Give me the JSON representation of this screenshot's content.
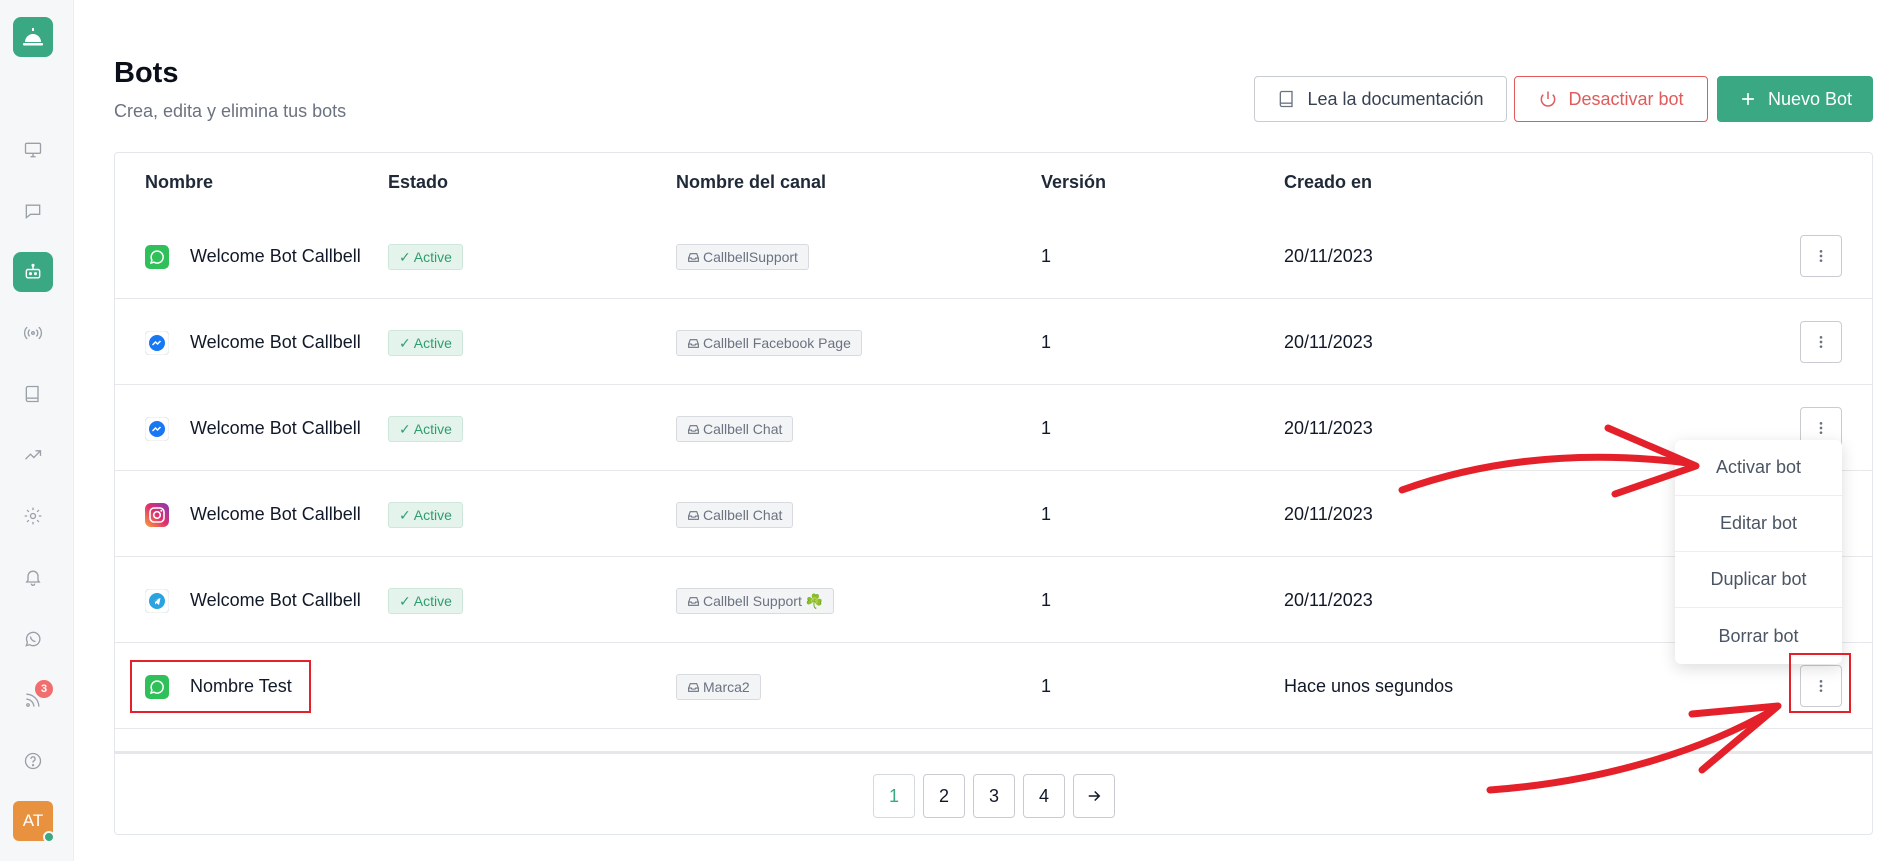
{
  "sidebar": {
    "logo_icon": "service-bell-icon",
    "items": [
      {
        "icon": "monitor-icon"
      },
      {
        "icon": "chat-bubble-icon"
      },
      {
        "icon": "bot-icon",
        "active": true
      },
      {
        "icon": "broadcast-icon"
      },
      {
        "icon": "book-icon"
      },
      {
        "icon": "trending-up-icon"
      },
      {
        "icon": "gear-icon"
      },
      {
        "icon": "bell-icon"
      },
      {
        "icon": "whatsapp-icon"
      },
      {
        "icon": "rss-feed-icon",
        "badge": "3"
      },
      {
        "icon": "help-circle-icon"
      }
    ],
    "avatar_initials": "AT"
  },
  "header": {
    "title": "Bots",
    "subtitle": "Crea, edita y elimina tus bots",
    "docs_button": "Lea la documentación",
    "deactivate_button": "Desactivar bot",
    "new_button": "Nuevo Bot"
  },
  "table": {
    "columns": [
      "Nombre",
      "Estado",
      "Nombre del canal",
      "Versión",
      "Creado en"
    ],
    "rows": [
      {
        "channel_icon": "whatsapp-icon",
        "name": "Welcome Bot Callbell",
        "status": "Active",
        "channel": "CallbellSupport",
        "version": "1",
        "created": "20/11/2023"
      },
      {
        "channel_icon": "messenger-icon",
        "name": "Welcome Bot Callbell",
        "status": "Active",
        "channel": "Callbell Facebook Page",
        "version": "1",
        "created": "20/11/2023"
      },
      {
        "channel_icon": "messenger-icon",
        "name": "Welcome Bot Callbell",
        "status": "Active",
        "channel": "Callbell Chat",
        "version": "1",
        "created": "20/11/2023"
      },
      {
        "channel_icon": "instagram-icon",
        "name": "Welcome Bot Callbell",
        "status": "Active",
        "channel": "Callbell Chat",
        "version": "1",
        "created": "20/11/2023"
      },
      {
        "channel_icon": "telegram-icon",
        "name": "Welcome Bot Callbell",
        "status": "Active",
        "channel": "Callbell Support ☘️",
        "version": "1",
        "created": "20/11/2023"
      },
      {
        "channel_icon": "whatsapp-icon",
        "name": "Nombre Test",
        "status": "",
        "channel": "Marca2",
        "version": "1",
        "created": "Hace unos segundos"
      }
    ]
  },
  "pagination": {
    "pages": [
      "1",
      "2",
      "3",
      "4"
    ],
    "current": "1",
    "next_icon": "arrow-right-icon"
  },
  "dropdown": {
    "items": [
      "Activar bot",
      "Editar bot",
      "Duplicar bot",
      "Borrar bot"
    ]
  },
  "colors": {
    "accent": "#3aa882",
    "danger": "#e05b5b",
    "annotation": "#e4212a"
  }
}
